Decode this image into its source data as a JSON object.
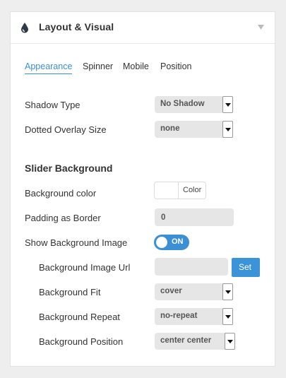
{
  "panel": {
    "title": "Layout & Visual",
    "icon": "water-drop-icon",
    "collapse_icon": "caret-down-icon"
  },
  "tabs": [
    {
      "label": "Appearance",
      "active": true
    },
    {
      "label": "Spinner",
      "active": false
    },
    {
      "label": "Mobile",
      "active": false
    },
    {
      "label": "Position",
      "active": false
    }
  ],
  "fields": {
    "shadow_type": {
      "label": "Shadow Type",
      "value": "No Shadow"
    },
    "dotted_overlay": {
      "label": "Dotted Overlay Size",
      "value": "none"
    }
  },
  "slider_background": {
    "title": "Slider Background",
    "bg_color": {
      "label": "Background color",
      "button_label": "Color",
      "swatch": "#ffffff"
    },
    "padding": {
      "label": "Padding as Border",
      "value": "0"
    },
    "show_image": {
      "label": "Show Background Image",
      "toggle_label": "ON",
      "on": true
    },
    "image_url": {
      "label": "Background Image Url",
      "value": "",
      "button_label": "Set"
    },
    "fit": {
      "label": "Background Fit",
      "value": "cover"
    },
    "repeat": {
      "label": "Background Repeat",
      "value": "no-repeat"
    },
    "position": {
      "label": "Background Position",
      "value": "center center"
    }
  },
  "colors": {
    "accent": "#3b8fd4",
    "field_bg": "#e6e6e6"
  }
}
